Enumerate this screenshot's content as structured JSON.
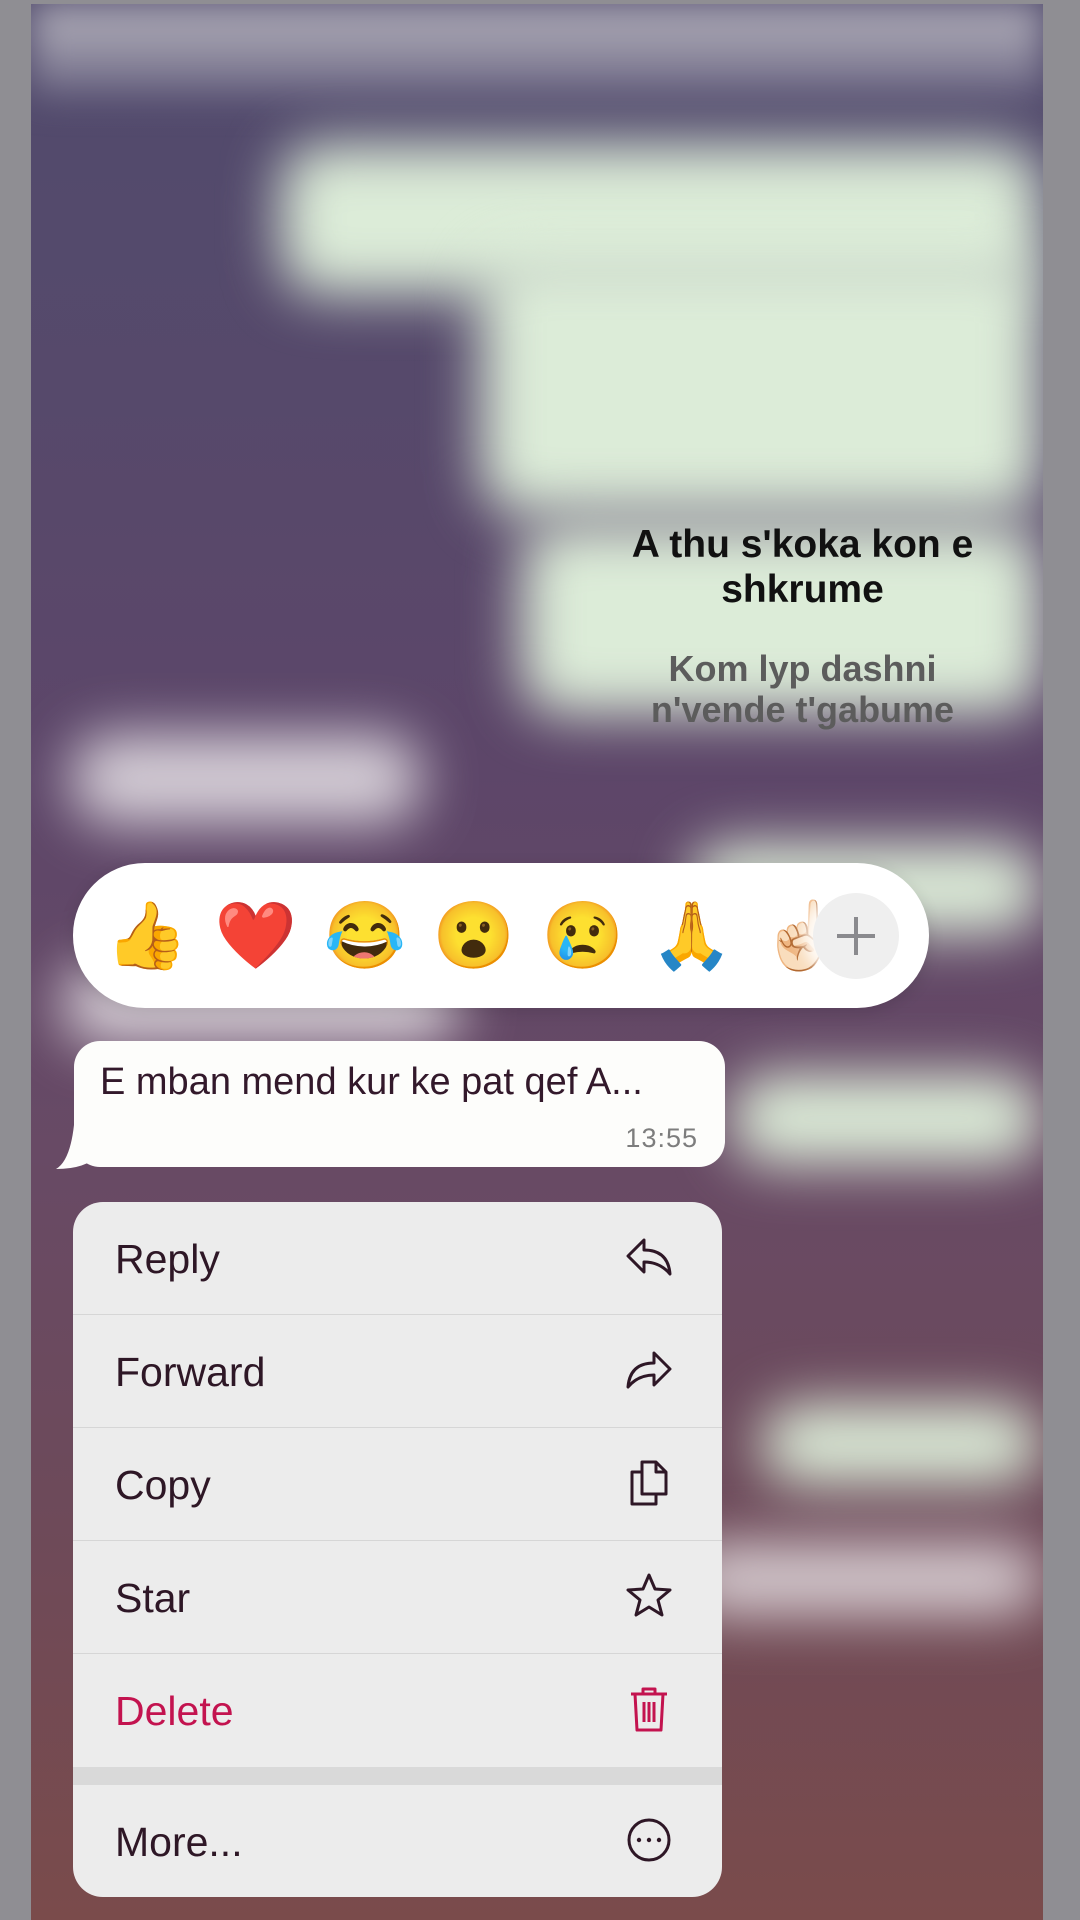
{
  "caption": {
    "line1": "A thu s'koka kon e shkrume",
    "line2": "Kom lyp dashni n'vende t'gabume"
  },
  "reactions": {
    "emojis": [
      "👍",
      "❤️",
      "😂",
      "😮",
      "😢",
      "🙏",
      "☝🏻"
    ],
    "more_icon": "plus-icon"
  },
  "message": {
    "text": "E mban mend kur ke pat qef A...",
    "time": "13:55"
  },
  "context_menu": {
    "items": [
      {
        "label": "Reply",
        "icon": "reply-icon"
      },
      {
        "label": "Forward",
        "icon": "forward-icon"
      },
      {
        "label": "Copy",
        "icon": "copy-icon"
      },
      {
        "label": "Star",
        "icon": "star-icon"
      },
      {
        "label": "Delete",
        "icon": "trash-icon"
      },
      {
        "label": "More...",
        "icon": "more-icon"
      }
    ]
  },
  "colors": {
    "destructive": "#c3134f",
    "menu_text": "#2e1726",
    "menu_background": "#ececec"
  }
}
